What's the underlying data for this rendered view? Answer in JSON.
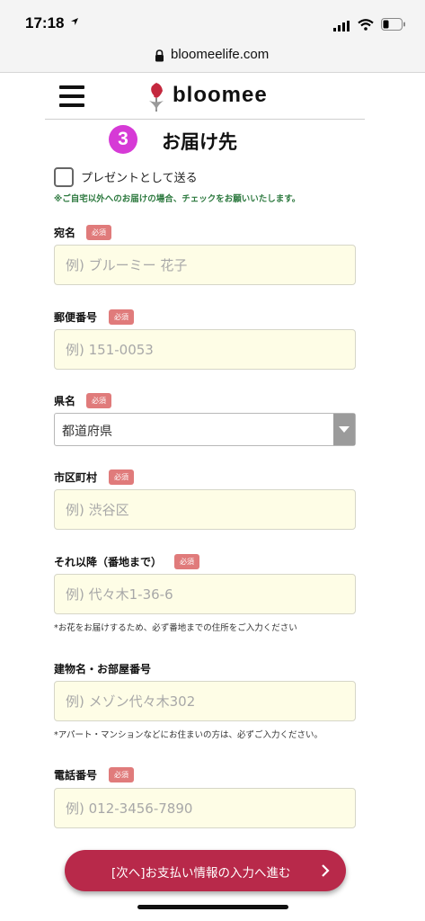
{
  "status_bar": {
    "time": "17:18"
  },
  "browser": {
    "url": "bloomeelife.com"
  },
  "header": {
    "logo_text": "bloomee"
  },
  "section": {
    "step_number": "3",
    "title": "お届け先"
  },
  "gift_option": {
    "label": "プレゼントとして送る",
    "checked": false,
    "note": "※ご自宅以外へのお届けの場合、チェックをお願いいたします。"
  },
  "required_badge": "必須",
  "fields": {
    "name": {
      "label": "宛名",
      "placeholder": "例) ブルーミー 花子"
    },
    "postal": {
      "label": "郵便番号",
      "placeholder": "例) 151-0053"
    },
    "prefecture": {
      "label": "県名",
      "selected": "都道府県"
    },
    "city": {
      "label": "市区町村",
      "placeholder": "例) 渋谷区"
    },
    "street": {
      "label": "それ以降（番地まで）",
      "placeholder": "例) 代々木1-36-6",
      "hint": "*お花をお届けするため、必ず番地までの住所をご入力ください"
    },
    "building": {
      "label": "建物名・お部屋番号",
      "placeholder": "例) メゾン代々木302",
      "hint": "*アパート・マンションなどにお住まいの方は、必ずご入力ください。"
    },
    "phone": {
      "label": "電話番号",
      "placeholder": "例) 012-3456-7890"
    }
  },
  "next_button": {
    "label": "[次へ]お支払い情報の入力へ進む"
  },
  "colors": {
    "step_circle": "#d63ad6",
    "required_badge": "#e07b7b",
    "input_bg": "#fefde6",
    "note_green": "#2e7a40",
    "next_button": "#b8294a"
  }
}
